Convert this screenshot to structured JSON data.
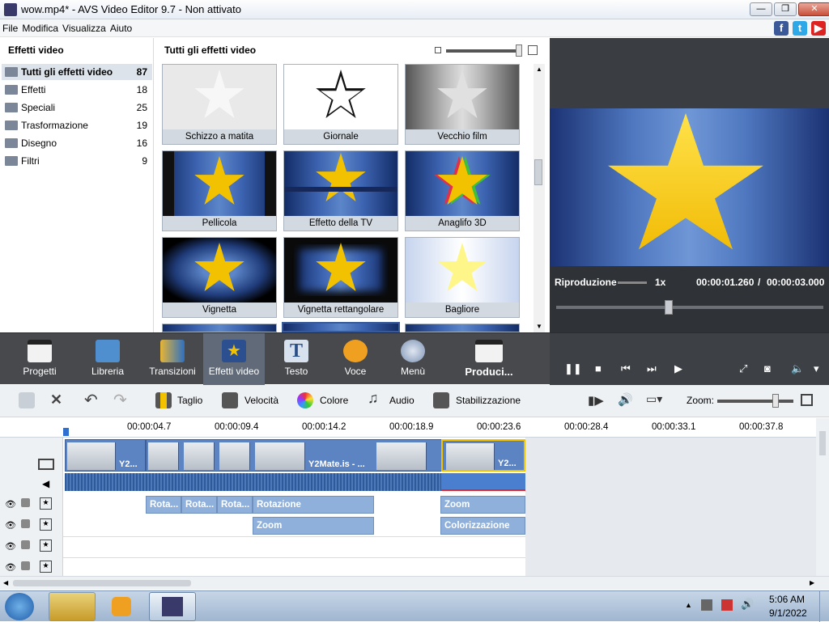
{
  "window": {
    "title": "wow.mp4* - AVS Video Editor 9.7 - Non attivato"
  },
  "menu": [
    "File",
    "Modifica",
    "Visualizza",
    "Aiuto"
  ],
  "left_panel": {
    "header": "Effetti video",
    "categories": [
      {
        "label": "Tutti gli effetti video",
        "count": "87"
      },
      {
        "label": "Effetti",
        "count": "18"
      },
      {
        "label": "Speciali",
        "count": "25"
      },
      {
        "label": "Trasformazione",
        "count": "19"
      },
      {
        "label": "Disegno",
        "count": "16"
      },
      {
        "label": "Filtri",
        "count": "9"
      }
    ]
  },
  "grid": {
    "header": "Tutti gli effetti video",
    "tiles": [
      "Schizzo a matita",
      "Giornale",
      "Vecchio film",
      "Pellicola",
      "Effetto della TV",
      "Anaglifo 3D",
      "Vignetta",
      "Vignetta rettangolare",
      "Bagliore"
    ]
  },
  "preview": {
    "status": "Riproduzione",
    "speed": "1x",
    "current_time": "00:00:01.260",
    "separator": "/",
    "total_time": "00:00:03.000",
    "progress": 0.42
  },
  "main_toolbar": {
    "buttons": [
      "Progetti",
      "Libreria",
      "Transizioni",
      "Effetti video",
      "Testo",
      "Voce",
      "Menù"
    ],
    "produce": "Produci..."
  },
  "edit_toolbar": {
    "taglio": "Taglio",
    "velocita": "Velocità",
    "colore": "Colore",
    "audio": "Audio",
    "stabilizzazione": "Stabilizzazione",
    "zoom": "Zoom:"
  },
  "timeline": {
    "ticks": [
      "00:00:04.7",
      "00:00:09.4",
      "00:00:14.2",
      "00:00:18.9",
      "00:00:23.6",
      "00:00:28.4",
      "00:00:33.1",
      "00:00:37.8"
    ],
    "clips": [
      "Y2...",
      "Y2Mate.is - ...",
      "Y2..."
    ],
    "effects_row1": [
      "Rota...",
      "Rota...",
      "Rota...",
      "Rotazione",
      "Zoom"
    ],
    "effects_row2": [
      "Zoom",
      "Colorizzazione"
    ]
  },
  "taskbar": {
    "time": "5:06 AM",
    "date": "9/1/2022"
  },
  "colors": {
    "accent": "#606a78",
    "toolbar": "#47494d",
    "clip": "#5d84c2",
    "effect": "#8fb0da",
    "star": "#f2c200"
  }
}
